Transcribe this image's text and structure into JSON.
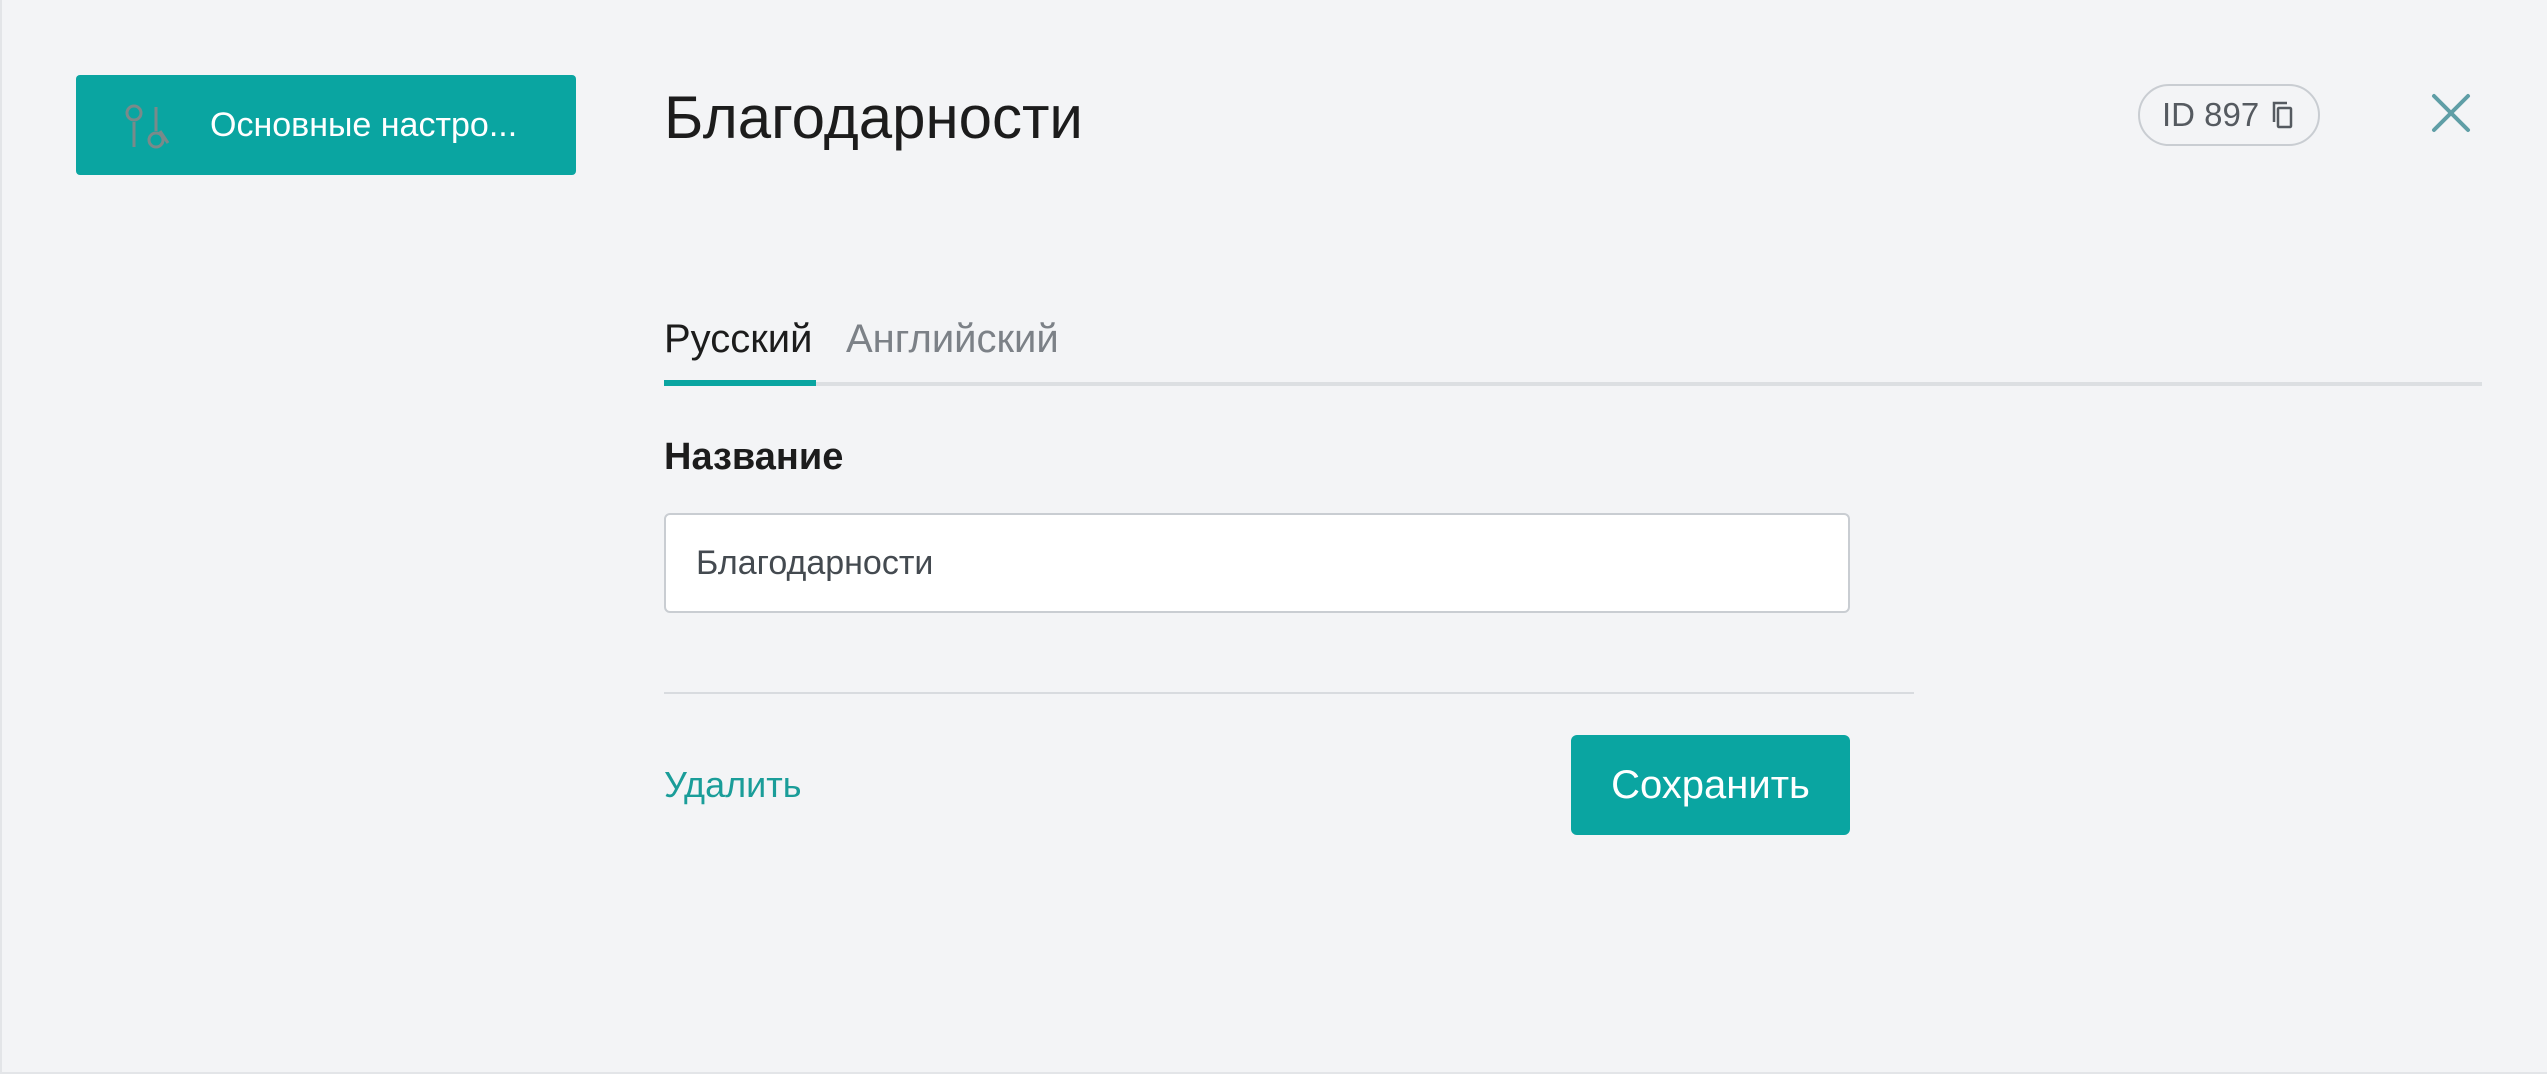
{
  "sidebar": {
    "items": [
      {
        "label": "Основные настро...",
        "icon": "settings-sliders-icon",
        "active": true
      }
    ]
  },
  "header": {
    "title": "Благодарности",
    "id_badge": "ID 897",
    "copy_icon": "copy-icon",
    "close_icon": "close-icon"
  },
  "tabs": [
    {
      "label": "Русский",
      "active": true
    },
    {
      "label": "Английский",
      "active": false
    }
  ],
  "form": {
    "name_label": "Название",
    "name_value": "Благодарности",
    "delete_label": "Удалить",
    "save_label": "Сохранить"
  },
  "colors": {
    "accent": "#0aa5a1",
    "background": "#f3f4f6",
    "link": "#1a9d99"
  }
}
